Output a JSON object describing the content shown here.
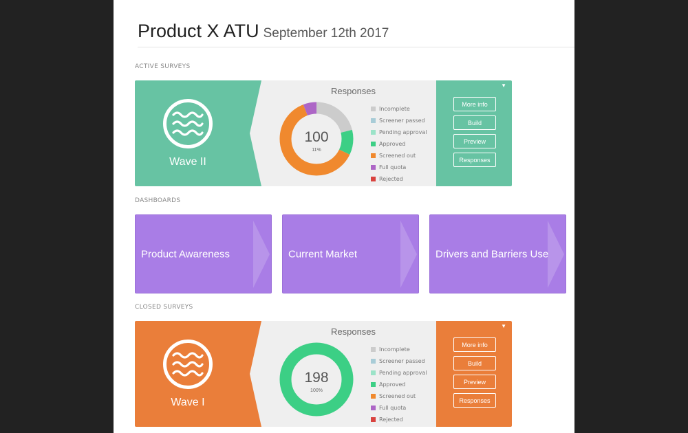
{
  "header": {
    "title": "Product X ATU",
    "date": "September 12th 2017"
  },
  "sections": {
    "active": "ACTIVE SURVEYS",
    "dashboards": "DASHBOARDS",
    "closed": "CLOSED SURVEYS"
  },
  "legend_labels": [
    "Incomplete",
    "Screener passed",
    "Pending approval",
    "Approved",
    "Screened out",
    "Full quota",
    "Rejected"
  ],
  "legend_colors": [
    "#cccccc",
    "#a8ccd7",
    "#9be3c8",
    "#3ccf85",
    "#f0892e",
    "#ad66c6",
    "#d9433f"
  ],
  "surveys": [
    {
      "name": "Wave II",
      "color": "#67c3a3",
      "icon": "wave-icon",
      "responses_title": "Responses",
      "total": "100",
      "percent": "11%",
      "segments": [
        {
          "label": "Incomplete",
          "value": 21,
          "color": "#cccccc"
        },
        {
          "label": "Approved",
          "value": 11,
          "color": "#3ccf85"
        },
        {
          "label": "Screened out",
          "value": 62,
          "color": "#f0892e"
        },
        {
          "label": "Full quota",
          "value": 6,
          "color": "#ad66c6"
        }
      ],
      "buttons": [
        "More info",
        "Build",
        "Preview",
        "Responses"
      ]
    },
    {
      "name": "Wave I",
      "color": "#ea7e3a",
      "icon": "wave-icon",
      "responses_title": "Responses",
      "total": "198",
      "percent": "100%",
      "segments": [
        {
          "label": "Approved",
          "value": 198,
          "color": "#3ccf85"
        }
      ],
      "buttons": [
        "More info",
        "Build",
        "Preview",
        "Responses"
      ]
    }
  ],
  "dashboards": [
    "Product Awareness",
    "Current Market",
    "Drivers and Barriers Use"
  ]
}
